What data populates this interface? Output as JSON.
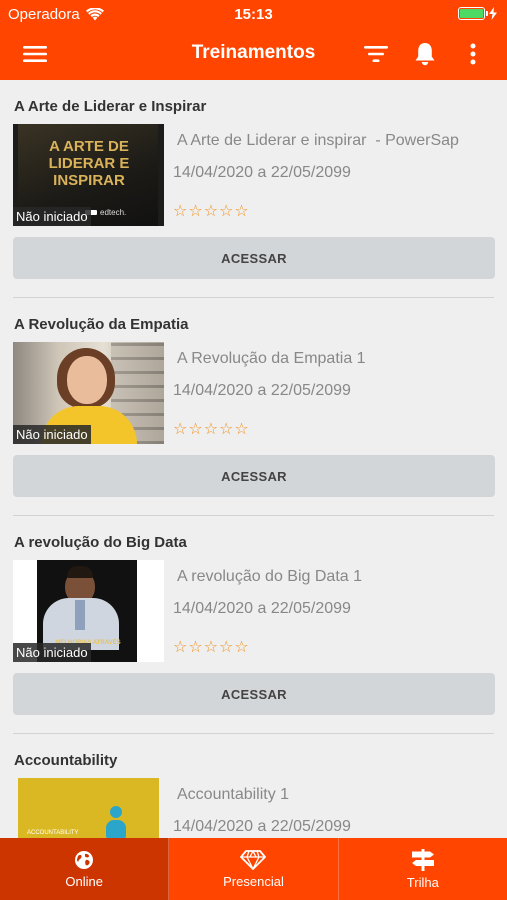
{
  "status_bar": {
    "carrier": "Operadora",
    "time": "15:13"
  },
  "header": {
    "title": "Treinamentos"
  },
  "courses": [
    {
      "title": "A Arte de Liderar e Inspirar",
      "name": "A Arte de Liderar e inspirar  - PowerSap",
      "dates": "14/04/2020 a 22/05/2099",
      "status": "Não iniciado",
      "rating": 0,
      "action": "ACESSAR",
      "thumb_text": "A ARTE DE LIDERAR E INSPIRAR",
      "thumb_brand": "edtech."
    },
    {
      "title": "A Revolução da Empatia",
      "name": "A Revolução da Empatia 1",
      "dates": "14/04/2020 a 22/05/2099",
      "status": "Não iniciado",
      "rating": 0,
      "action": "ACESSAR"
    },
    {
      "title": "A revolução do Big Data",
      "name": "A revolução do Big Data 1",
      "dates": "14/04/2020 a 22/05/2099",
      "status": "Não iniciado",
      "rating": 0,
      "action": "ACESSAR",
      "thumb_text": "MELHORIAS ATRAVÉS"
    },
    {
      "title": "Accountability",
      "name": "Accountability 1",
      "dates": "14/04/2020 a 22/05/2099",
      "thumb_text": "ACCOUNTABILITY"
    }
  ],
  "tabs": [
    {
      "label": "Online",
      "icon": "globe-icon",
      "active": true
    },
    {
      "label": "Presencial",
      "icon": "diamond-icon",
      "active": false
    },
    {
      "label": "Trilha",
      "icon": "signpost-icon",
      "active": false
    }
  ],
  "colors": {
    "primary": "#ff4500",
    "active_tab": "#cc3500",
    "star": "#f0901e",
    "button": "#d2d6d8"
  }
}
